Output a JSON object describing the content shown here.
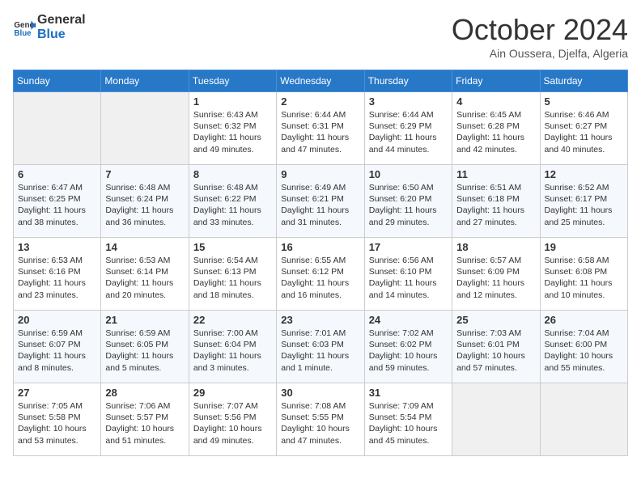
{
  "logo": {
    "line1": "General",
    "line2": "Blue"
  },
  "header": {
    "month": "October 2024",
    "location": "Ain Oussera, Djelfa, Algeria"
  },
  "weekdays": [
    "Sunday",
    "Monday",
    "Tuesday",
    "Wednesday",
    "Thursday",
    "Friday",
    "Saturday"
  ],
  "weeks": [
    [
      {
        "day": "",
        "empty": true
      },
      {
        "day": "",
        "empty": true
      },
      {
        "day": "1",
        "sunrise": "6:43 AM",
        "sunset": "6:32 PM",
        "daylight": "11 hours and 49 minutes."
      },
      {
        "day": "2",
        "sunrise": "6:44 AM",
        "sunset": "6:31 PM",
        "daylight": "11 hours and 47 minutes."
      },
      {
        "day": "3",
        "sunrise": "6:44 AM",
        "sunset": "6:29 PM",
        "daylight": "11 hours and 44 minutes."
      },
      {
        "day": "4",
        "sunrise": "6:45 AM",
        "sunset": "6:28 PM",
        "daylight": "11 hours and 42 minutes."
      },
      {
        "day": "5",
        "sunrise": "6:46 AM",
        "sunset": "6:27 PM",
        "daylight": "11 hours and 40 minutes."
      }
    ],
    [
      {
        "day": "6",
        "sunrise": "6:47 AM",
        "sunset": "6:25 PM",
        "daylight": "11 hours and 38 minutes."
      },
      {
        "day": "7",
        "sunrise": "6:48 AM",
        "sunset": "6:24 PM",
        "daylight": "11 hours and 36 minutes."
      },
      {
        "day": "8",
        "sunrise": "6:48 AM",
        "sunset": "6:22 PM",
        "daylight": "11 hours and 33 minutes."
      },
      {
        "day": "9",
        "sunrise": "6:49 AM",
        "sunset": "6:21 PM",
        "daylight": "11 hours and 31 minutes."
      },
      {
        "day": "10",
        "sunrise": "6:50 AM",
        "sunset": "6:20 PM",
        "daylight": "11 hours and 29 minutes."
      },
      {
        "day": "11",
        "sunrise": "6:51 AM",
        "sunset": "6:18 PM",
        "daylight": "11 hours and 27 minutes."
      },
      {
        "day": "12",
        "sunrise": "6:52 AM",
        "sunset": "6:17 PM",
        "daylight": "11 hours and 25 minutes."
      }
    ],
    [
      {
        "day": "13",
        "sunrise": "6:53 AM",
        "sunset": "6:16 PM",
        "daylight": "11 hours and 23 minutes."
      },
      {
        "day": "14",
        "sunrise": "6:53 AM",
        "sunset": "6:14 PM",
        "daylight": "11 hours and 20 minutes."
      },
      {
        "day": "15",
        "sunrise": "6:54 AM",
        "sunset": "6:13 PM",
        "daylight": "11 hours and 18 minutes."
      },
      {
        "day": "16",
        "sunrise": "6:55 AM",
        "sunset": "6:12 PM",
        "daylight": "11 hours and 16 minutes."
      },
      {
        "day": "17",
        "sunrise": "6:56 AM",
        "sunset": "6:10 PM",
        "daylight": "11 hours and 14 minutes."
      },
      {
        "day": "18",
        "sunrise": "6:57 AM",
        "sunset": "6:09 PM",
        "daylight": "11 hours and 12 minutes."
      },
      {
        "day": "19",
        "sunrise": "6:58 AM",
        "sunset": "6:08 PM",
        "daylight": "11 hours and 10 minutes."
      }
    ],
    [
      {
        "day": "20",
        "sunrise": "6:59 AM",
        "sunset": "6:07 PM",
        "daylight": "11 hours and 8 minutes."
      },
      {
        "day": "21",
        "sunrise": "6:59 AM",
        "sunset": "6:05 PM",
        "daylight": "11 hours and 5 minutes."
      },
      {
        "day": "22",
        "sunrise": "7:00 AM",
        "sunset": "6:04 PM",
        "daylight": "11 hours and 3 minutes."
      },
      {
        "day": "23",
        "sunrise": "7:01 AM",
        "sunset": "6:03 PM",
        "daylight": "11 hours and 1 minute."
      },
      {
        "day": "24",
        "sunrise": "7:02 AM",
        "sunset": "6:02 PM",
        "daylight": "10 hours and 59 minutes."
      },
      {
        "day": "25",
        "sunrise": "7:03 AM",
        "sunset": "6:01 PM",
        "daylight": "10 hours and 57 minutes."
      },
      {
        "day": "26",
        "sunrise": "7:04 AM",
        "sunset": "6:00 PM",
        "daylight": "10 hours and 55 minutes."
      }
    ],
    [
      {
        "day": "27",
        "sunrise": "7:05 AM",
        "sunset": "5:58 PM",
        "daylight": "10 hours and 53 minutes."
      },
      {
        "day": "28",
        "sunrise": "7:06 AM",
        "sunset": "5:57 PM",
        "daylight": "10 hours and 51 minutes."
      },
      {
        "day": "29",
        "sunrise": "7:07 AM",
        "sunset": "5:56 PM",
        "daylight": "10 hours and 49 minutes."
      },
      {
        "day": "30",
        "sunrise": "7:08 AM",
        "sunset": "5:55 PM",
        "daylight": "10 hours and 47 minutes."
      },
      {
        "day": "31",
        "sunrise": "7:09 AM",
        "sunset": "5:54 PM",
        "daylight": "10 hours and 45 minutes."
      },
      {
        "day": "",
        "empty": true
      },
      {
        "day": "",
        "empty": true
      }
    ]
  ],
  "labels": {
    "sunrise": "Sunrise:",
    "sunset": "Sunset:",
    "daylight": "Daylight:"
  }
}
